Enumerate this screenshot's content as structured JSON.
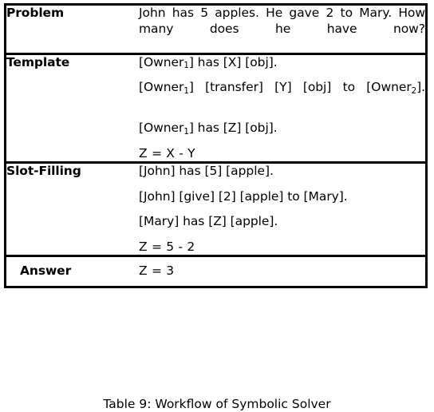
{
  "document": {
    "type": "academic-table-figure",
    "background_color": "#ffffff",
    "text_color": "#000000",
    "rule_color": "#000000"
  },
  "table": {
    "rows": [
      {
        "label": "Problem",
        "kind": "paragraph",
        "lines": [
          "John has 5 apples.  He gave 2 to Mary.  How many does he have now?"
        ]
      },
      {
        "label": "Template",
        "kind": "list",
        "lines": [
          {
            "pre": "[Owner",
            "sub": "1",
            "post": "] has [X] [obj]."
          },
          {
            "pre": "[Owner",
            "sub": "1",
            "post": "] [transfer] [Y] [obj] to [Owner",
            "sub2": "2",
            "post2": "]."
          },
          {
            "pre": "[Owner",
            "sub": "1",
            "post": "] has [Z] [obj]."
          },
          {
            "plain": "Z = X - Y"
          }
        ]
      },
      {
        "label": "Slot-Filling",
        "kind": "list",
        "lines": [
          {
            "plain": "[John] has [5] [apple]."
          },
          {
            "plain": "[John] [give] [2] [apple] to [Mary]."
          },
          {
            "plain": "[Mary] has [Z] [apple]."
          },
          {
            "plain": "Z = 5 - 2"
          }
        ]
      },
      {
        "label": "Answer",
        "kind": "single",
        "lines": [
          {
            "plain": "Z = 3"
          }
        ]
      }
    ]
  },
  "caption": {
    "text": "Table 9: Workflow of Symbolic Solver",
    "clipped": true
  }
}
